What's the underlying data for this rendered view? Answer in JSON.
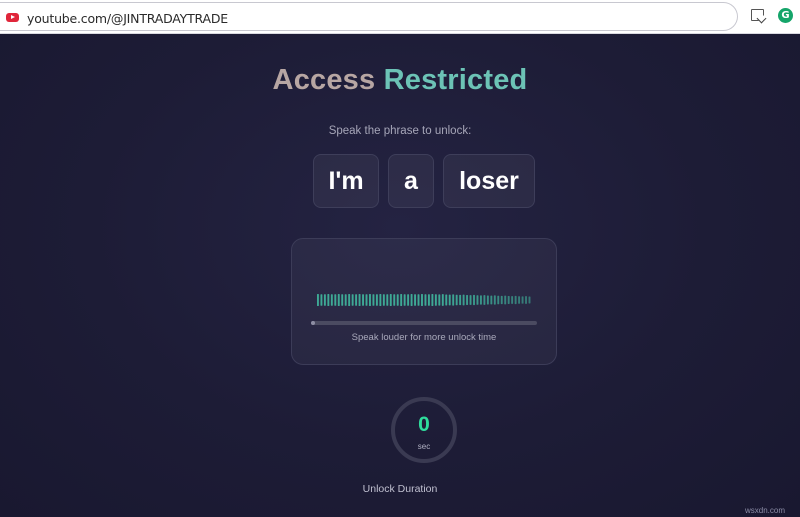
{
  "browser": {
    "url": "youtube.com/@JINTRADAYTRADE",
    "site_icon": "youtube-icon",
    "install_icon": "install-app-icon",
    "extension_icon": "grammarly-icon",
    "extension_glyph": "G"
  },
  "header": {
    "title_part1": "Access",
    "title_part2": "Restricted",
    "title_color1": "#b7a6a3",
    "title_color2": "#6cc3b6"
  },
  "instruction": "Speak the phrase to unlock:",
  "phrase_words": [
    "I'm",
    "a",
    "loser"
  ],
  "meter": {
    "progress": 0.01,
    "hint": "Speak louder for more unlock time",
    "bar_color": "#3fb09a"
  },
  "timer": {
    "value": "0",
    "unit": "sec",
    "label": "Unlock Duration",
    "value_color": "#2fdc9c"
  },
  "watermark": "wsxdn.com"
}
